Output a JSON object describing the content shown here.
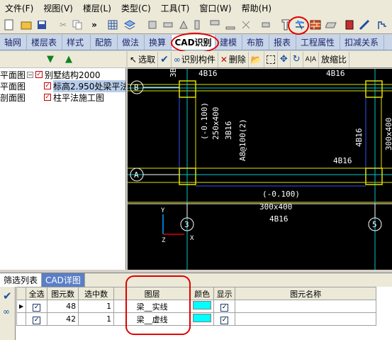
{
  "menubar": {
    "items": [
      "文件(F)",
      "视图(V)",
      "楼层(L)",
      "类型(C)",
      "工具(T)",
      "窗口(W)",
      "帮助(H)"
    ]
  },
  "tabbar": {
    "tabs": [
      "轴网",
      "楼层表",
      "样式",
      "配筋",
      "做法",
      "换算",
      "CAD识别",
      "建模",
      "布筋",
      "报表",
      "工程属性",
      "扣减关系"
    ],
    "active": "CAD识别"
  },
  "tree": {
    "root": "别墅结构2000",
    "items": [
      "标高2.950处梁平法",
      "柱平法施工图"
    ],
    "left_labels": [
      "平面图",
      "平面图",
      "剖面图"
    ]
  },
  "cad_toolbar": {
    "select_label": "选取",
    "identify_label": "识别构件",
    "delete_label": "删除",
    "zoom_label": "放缩比"
  },
  "canvas": {
    "axis_labels": [
      "B",
      "A",
      "3",
      "5"
    ],
    "texts": [
      "4B16",
      "4B16",
      "3B16",
      "(-0.100)",
      "250x400",
      "3B16",
      "A8@100(2)",
      "4B16",
      "300x400",
      "4B16",
      "(-0.100)",
      "300x400",
      "4B16"
    ],
    "axis_x": "X",
    "axis_y": "Y",
    "axis_z": "Z"
  },
  "bottom": {
    "tabs": [
      "筛选列表",
      "CAD详图"
    ],
    "columns": [
      "全选",
      "图元数",
      "选中数",
      "图层",
      "颜色",
      "显示",
      "图元名称"
    ],
    "rows": [
      {
        "count": "48",
        "selected": "1",
        "layer": "梁__实线",
        "name": ""
      },
      {
        "count": "42",
        "selected": "1",
        "layer": "梁__虚线",
        "name": ""
      }
    ]
  },
  "colors": {
    "layer_color": "#00ffff",
    "highlight": "#e00000"
  }
}
